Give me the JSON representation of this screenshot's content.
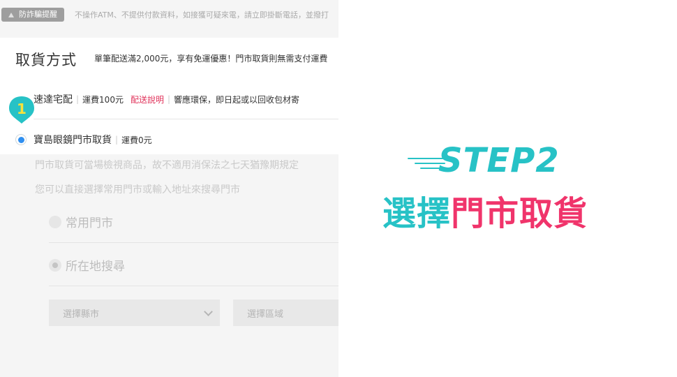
{
  "fraud_alert": {
    "badge": "防詐騙提醒",
    "text": "不操作ATM、不提供付款資料，如接獲可疑來電，請立即掛斷電話，並撥打"
  },
  "delivery": {
    "title": "取貨方式",
    "promo": "單筆配送滿2,000元，享有免運優惠！門市取貨則無需支付運費",
    "options": [
      {
        "label": "速達宅配",
        "fee": "運費100元",
        "link": "配送說明",
        "note": "響應環保，即日起或以回收包材寄"
      },
      {
        "label": "寶島眼鏡門市取貨",
        "fee": "運費0元",
        "selected": true
      }
    ],
    "marker_number": "1"
  },
  "store_pickup": {
    "note1": "門市取貨可當場檢視商品，故不適用消保法之七天猶豫期規定",
    "note2": "您可以直接選擇常用門市或輸入地址來搜尋門市",
    "mode_common": "常用門市",
    "mode_location": "所在地搜尋",
    "select_city_placeholder": "選擇縣市",
    "select_district_placeholder": "選擇區域"
  },
  "step": {
    "label": "STEP2",
    "title_part1": "選擇",
    "title_part2": "門市取貨"
  },
  "colors": {
    "accent_teal": "#27c2c6",
    "accent_pink": "#f0346b",
    "radio_blue": "#2f8ff0",
    "marker_teal": "#27c2c6",
    "marker_yellow": "#f7e23b"
  }
}
